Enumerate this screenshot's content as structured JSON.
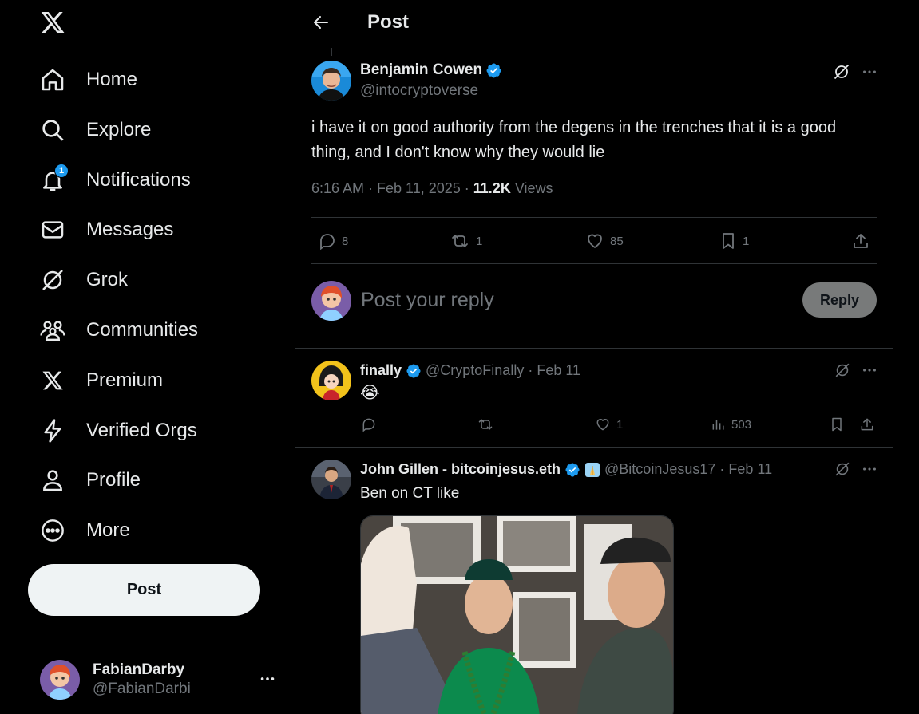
{
  "sidebar": {
    "nav": [
      {
        "label": "Home",
        "icon": "home-icon"
      },
      {
        "label": "Explore",
        "icon": "search-icon"
      },
      {
        "label": "Notifications",
        "icon": "bell-icon",
        "badge": "1"
      },
      {
        "label": "Messages",
        "icon": "envelope-icon"
      },
      {
        "label": "Grok",
        "icon": "grok-icon"
      },
      {
        "label": "Communities",
        "icon": "communities-icon"
      },
      {
        "label": "Premium",
        "icon": "x-logo-icon"
      },
      {
        "label": "Verified Orgs",
        "icon": "lightning-icon"
      },
      {
        "label": "Profile",
        "icon": "person-icon"
      },
      {
        "label": "More",
        "icon": "more-circle-icon"
      }
    ],
    "post_button": "Post",
    "account": {
      "name": "FabianDarby",
      "handle": "@FabianDarbi"
    }
  },
  "header": {
    "title": "Post"
  },
  "tweet": {
    "author_name": "Benjamin Cowen",
    "author_handle": "@intocryptoverse",
    "text": "i have it on good authority from the degens in the trenches that it is a good thing, and I don't know why they would lie",
    "time": "6:16 AM · Feb 11, 2025 · ",
    "views_count": "11.2K",
    "views_label": "Views",
    "replies": "8",
    "reposts": "1",
    "likes": "85",
    "bookmarks": "1"
  },
  "reply_box": {
    "placeholder": "Post your reply",
    "button": "Reply"
  },
  "replies": [
    {
      "name": "finally",
      "handle": "@CryptoFinally",
      "date": "· Feb 11",
      "body": "😭",
      "replies": "",
      "reposts": "",
      "likes": "1",
      "views": "503"
    },
    {
      "name": "John Gillen - bitcoinjesus.eth",
      "handle": "@BitcoinJesus17",
      "date": "· Feb 11",
      "body": "Ben on CT like"
    }
  ],
  "colors": {
    "accent": "#1d9bf0",
    "background": "#000000",
    "muted": "#71767b",
    "border": "#2f3336"
  }
}
